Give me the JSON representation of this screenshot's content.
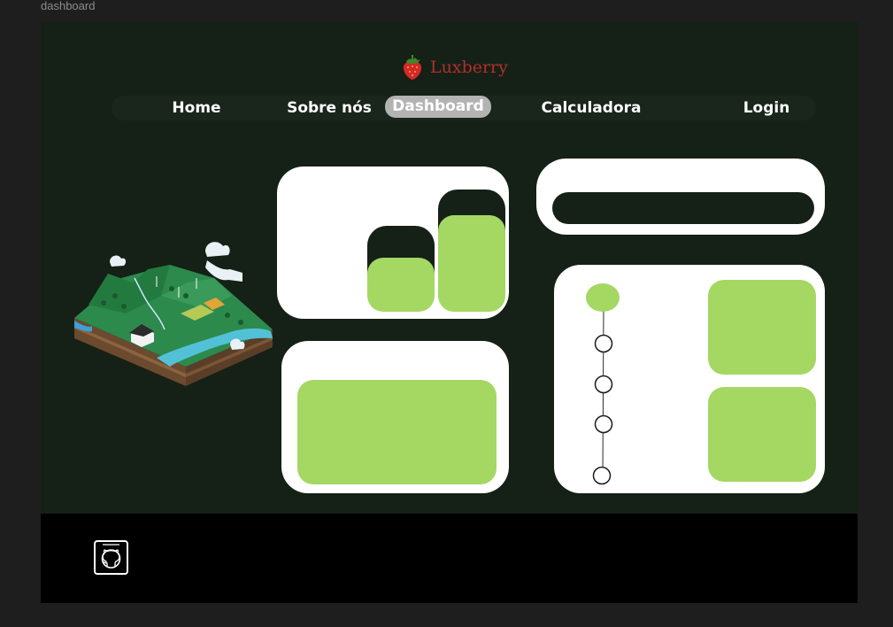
{
  "frame": {
    "label": "dashboard"
  },
  "brand": {
    "name": "Luxberry",
    "icon": "strawberry-icon"
  },
  "nav": {
    "items": [
      {
        "label": "Home"
      },
      {
        "label": "Sobre nós"
      },
      {
        "label": "Dashboard",
        "active": true
      },
      {
        "label": "Calculadora"
      },
      {
        "label": "Login"
      }
    ]
  },
  "footer": {
    "icon": "github-icon"
  },
  "colors": {
    "background": "#152016",
    "accent_green": "#a4d862",
    "brand_red": "#b22f2c",
    "card": "#ffffff",
    "footer": "#000000",
    "nav_active": "#b3b3b3"
  }
}
